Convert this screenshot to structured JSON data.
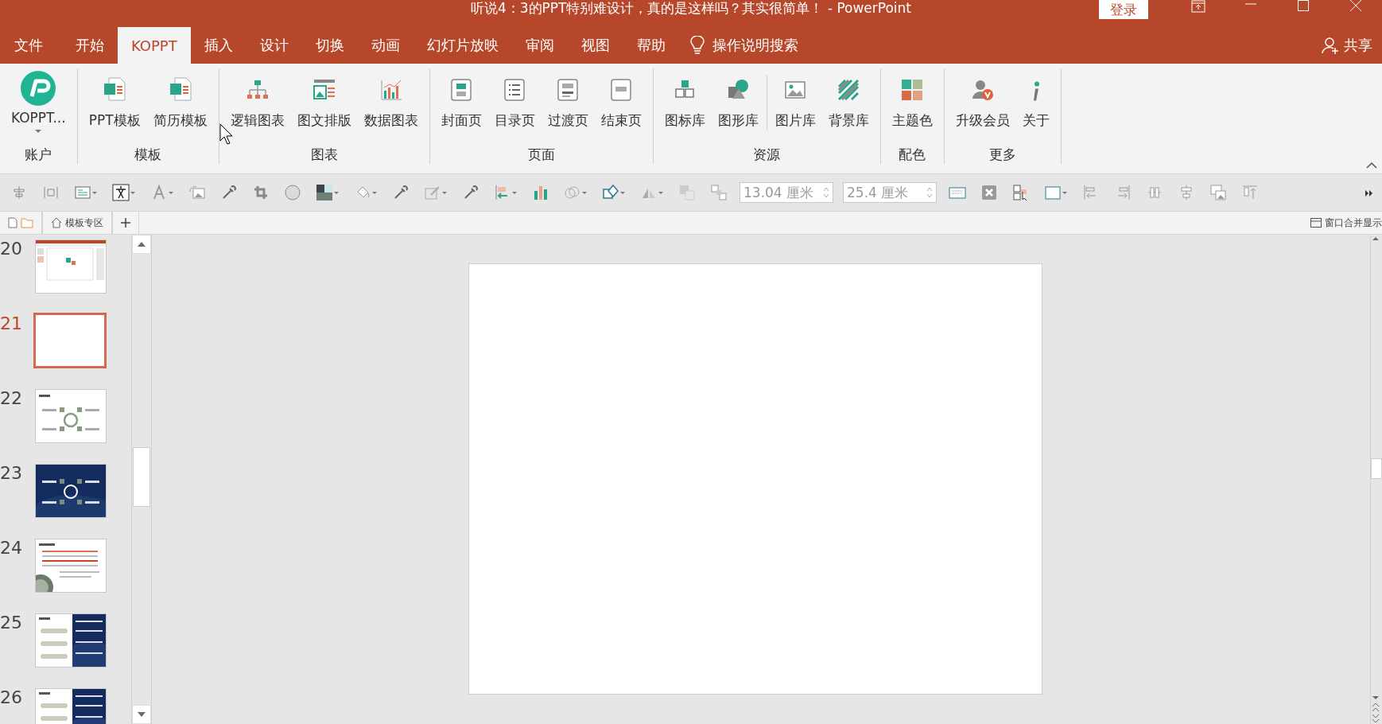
{
  "window": {
    "title": "听说4：3的PPT特别难设计，真的是这样吗？其实很简单！  -  PowerPoint",
    "login": "登录"
  },
  "tabs": [
    {
      "label": "文件",
      "selected": false
    },
    {
      "label": "开始",
      "selected": false
    },
    {
      "label": "KOPPT",
      "selected": true
    },
    {
      "label": "插入",
      "selected": false
    },
    {
      "label": "设计",
      "selected": false
    },
    {
      "label": "切换",
      "selected": false
    },
    {
      "label": "动画",
      "selected": false
    },
    {
      "label": "幻灯片放映",
      "selected": false
    },
    {
      "label": "审阅",
      "selected": false
    },
    {
      "label": "视图",
      "selected": false
    },
    {
      "label": "帮助",
      "selected": false
    }
  ],
  "search": {
    "placeholder": "操作说明搜索"
  },
  "share": "共享",
  "ribbon": {
    "groups": [
      {
        "label": "账户",
        "items": [
          {
            "label": "KOPPT...",
            "dropdown": true
          }
        ]
      },
      {
        "label": "模板",
        "items": [
          {
            "label": "PPT模板"
          },
          {
            "label": "简历模板"
          }
        ]
      },
      {
        "label": "图表",
        "items": [
          {
            "label": "逻辑图表"
          },
          {
            "label": "图文排版"
          },
          {
            "label": "数据图表"
          }
        ]
      },
      {
        "label": "页面",
        "items": [
          {
            "label": "封面页"
          },
          {
            "label": "目录页"
          },
          {
            "label": "过渡页"
          },
          {
            "label": "结束页"
          }
        ]
      },
      {
        "label": "资源",
        "items": [
          {
            "label": "图标库"
          },
          {
            "label": "图形库"
          },
          {
            "label": "图片库"
          },
          {
            "label": "背景库"
          }
        ]
      },
      {
        "label": "配色",
        "items": [
          {
            "label": "主题色"
          }
        ]
      },
      {
        "label": "更多",
        "items": [
          {
            "label": "升级会员"
          },
          {
            "label": "关于"
          }
        ]
      }
    ]
  },
  "toolbar": {
    "fields": [
      {
        "value": "13.04 厘米"
      },
      {
        "value": "25.4 厘米"
      }
    ]
  },
  "doc_tabs": [
    {
      "label": "模板专区"
    }
  ],
  "merge_windows": "窗口合并显示",
  "slides": [
    {
      "number": "20",
      "selected": false,
      "kind": "screenshot"
    },
    {
      "number": "21",
      "selected": true,
      "kind": "blank"
    },
    {
      "number": "22",
      "selected": false,
      "kind": "diagram"
    },
    {
      "number": "23",
      "selected": false,
      "kind": "dark-diagram"
    },
    {
      "number": "24",
      "selected": false,
      "kind": "text"
    },
    {
      "number": "25",
      "selected": false,
      "kind": "dark-list"
    },
    {
      "number": "26",
      "selected": false,
      "kind": "dark-list"
    }
  ]
}
